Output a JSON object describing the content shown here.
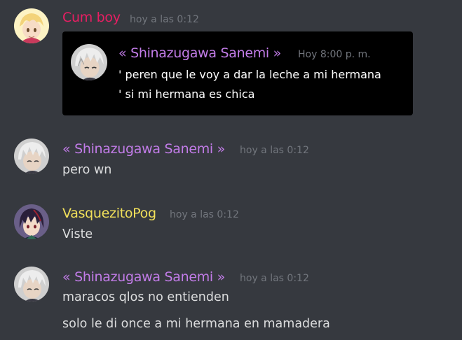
{
  "messages": [
    {
      "author": "Cum boy",
      "author_color": "#e91e63",
      "time": "hoy a las 0:12",
      "avatar_icon": "blonde-anime-boy-avatar",
      "quote": {
        "author": "« Shinazugawa Sanemi   »",
        "author_color": "#c27ce8",
        "time": "Hoy 8:00 p. m.",
        "avatar_icon": "white-haired-anime-avatar",
        "lines": [
          "' peren que le voy a dar la leche a mi hermana",
          "' si mi hermana es chica"
        ]
      }
    },
    {
      "author": "« Shinazugawa Sanemi   »",
      "author_color": "#c27ce8",
      "time": "hoy a las 0:12",
      "avatar_icon": "white-haired-anime-avatar",
      "lines": [
        "pero wn"
      ]
    },
    {
      "author": "VasquezitoPog",
      "author_color": "#f1e05a",
      "time": "hoy a las 0:12",
      "avatar_icon": "dark-haired-anime-avatar",
      "lines": [
        "Viste"
      ]
    },
    {
      "author": "« Shinazugawa Sanemi   »",
      "author_color": "#c27ce8",
      "time": "hoy a las 0:12",
      "avatar_icon": "white-haired-anime-avatar",
      "lines": [
        "maracos qlos no entienden",
        "solo le di once a mi hermana en mamadera"
      ]
    }
  ]
}
